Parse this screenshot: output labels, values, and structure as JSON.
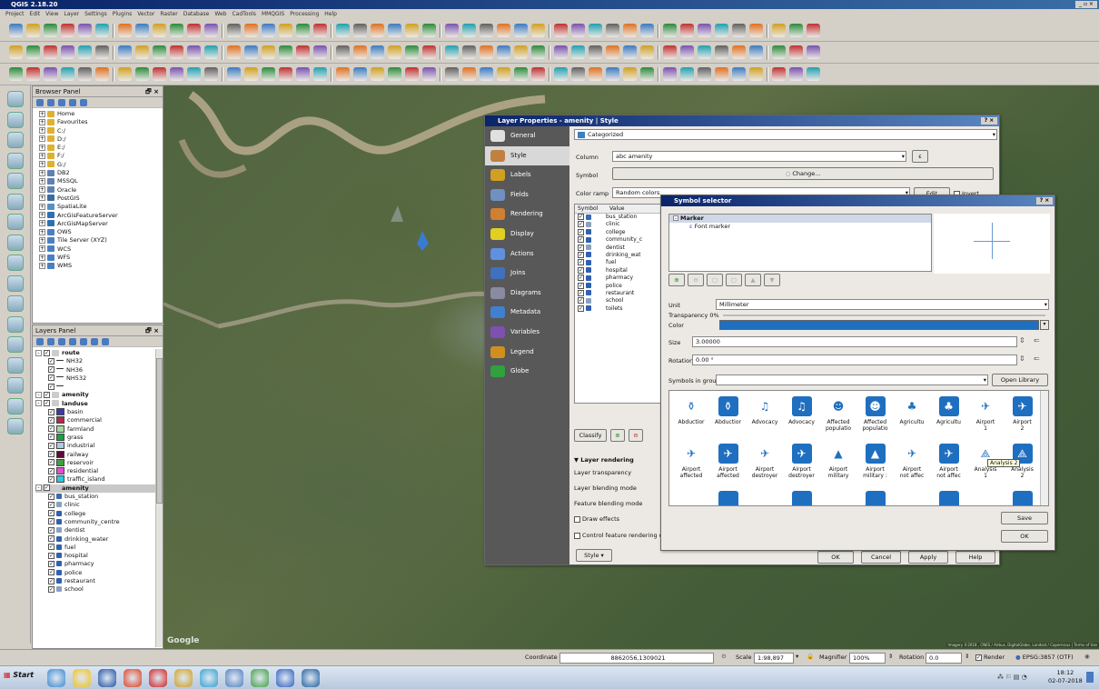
{
  "window": {
    "title": "QGIS 2.18.20",
    "controls": "_ ▫ ×"
  },
  "menu": [
    "Project",
    "Edit",
    "View",
    "Layer",
    "Settings",
    "Plugins",
    "Vector",
    "Raster",
    "Database",
    "Web",
    "CadTools",
    "MMQGIS",
    "Processing",
    "Help"
  ],
  "browser": {
    "title": "Browser Panel",
    "close": "🗗 ×",
    "items": [
      {
        "label": "Home",
        "indent": 1,
        "icon": "folder-icon",
        "color": "#e0b030"
      },
      {
        "label": "Favourites",
        "indent": 1,
        "icon": "star-icon",
        "color": "#e0b030"
      },
      {
        "label": "C:/",
        "indent": 1,
        "icon": "folder-icon",
        "color": "#e0b030"
      },
      {
        "label": "D:/",
        "indent": 1,
        "icon": "folder-icon",
        "color": "#e0b030"
      },
      {
        "label": "E:/",
        "indent": 1,
        "icon": "folder-icon",
        "color": "#e0b030"
      },
      {
        "label": "F:/",
        "indent": 1,
        "icon": "folder-icon",
        "color": "#e0b030"
      },
      {
        "label": "G:/",
        "indent": 1,
        "icon": "folder-icon",
        "color": "#e0b030"
      },
      {
        "label": "DB2",
        "indent": 1,
        "icon": "database-icon",
        "color": "#6080b0"
      },
      {
        "label": "MSSQL",
        "indent": 1,
        "icon": "database-icon",
        "color": "#6080b0"
      },
      {
        "label": "Oracle",
        "indent": 1,
        "icon": "database-icon",
        "color": "#6080b0"
      },
      {
        "label": "PostGIS",
        "indent": 1,
        "icon": "database-icon",
        "color": "#3a6aa0"
      },
      {
        "label": "SpatiaLite",
        "indent": 1,
        "icon": "database-icon",
        "color": "#5a90c0"
      },
      {
        "label": "ArcGisFeatureServer",
        "indent": 1,
        "icon": "globe-icon",
        "color": "#3070b0"
      },
      {
        "label": "ArcGisMapServer",
        "indent": 1,
        "icon": "globe-icon",
        "color": "#3070b0"
      },
      {
        "label": "OWS",
        "indent": 1,
        "icon": "globe-icon",
        "color": "#4a80c0"
      },
      {
        "label": "Tile Server (XYZ)",
        "indent": 1,
        "icon": "globe-icon",
        "color": "#4a80c0"
      },
      {
        "label": "WCS",
        "indent": 1,
        "icon": "globe-icon",
        "color": "#4a80c0"
      },
      {
        "label": "WFS",
        "indent": 1,
        "icon": "globe-icon",
        "color": "#4a80c0"
      },
      {
        "label": "WMS",
        "indent": 1,
        "icon": "globe-icon",
        "color": "#4a80c0"
      }
    ]
  },
  "layers": {
    "title": "Layers Panel",
    "close": "🗗 ×",
    "items": [
      {
        "label": "route",
        "bold": true,
        "indent": 0,
        "type": "group"
      },
      {
        "label": "NH32",
        "indent": 2,
        "type": "line"
      },
      {
        "label": "NH36",
        "indent": 2,
        "type": "line"
      },
      {
        "label": "NH532",
        "indent": 2,
        "type": "line"
      },
      {
        "label": "",
        "indent": 2,
        "type": "line"
      },
      {
        "label": "amenity",
        "bold": true,
        "indent": 0,
        "type": "group"
      },
      {
        "label": "landuse",
        "bold": true,
        "indent": 0,
        "type": "group"
      },
      {
        "label": "basin",
        "indent": 2,
        "type": "fill",
        "color": "#3a3aa8"
      },
      {
        "label": "commercial",
        "indent": 2,
        "type": "fill",
        "color": "#b02a4a"
      },
      {
        "label": "farmland",
        "indent": 2,
        "type": "fill",
        "color": "#a8d8a0"
      },
      {
        "label": "grass",
        "indent": 2,
        "type": "fill",
        "color": "#1aa040"
      },
      {
        "label": "industrial",
        "indent": 2,
        "type": "fill",
        "color": "#b0c8e0"
      },
      {
        "label": "railway",
        "indent": 2,
        "type": "fill",
        "color": "#5a0a3a"
      },
      {
        "label": "reservoir",
        "indent": 2,
        "type": "fill",
        "color": "#40a040"
      },
      {
        "label": "residential",
        "indent": 2,
        "type": "fill",
        "color": "#e050d0"
      },
      {
        "label": "traffic_island",
        "indent": 2,
        "type": "fill",
        "color": "#30c8e0"
      },
      {
        "label": "amenity",
        "bold": true,
        "indent": 0,
        "type": "group",
        "selected": true
      },
      {
        "label": "bus_station",
        "indent": 2,
        "type": "pt",
        "color": "#3a6ab0"
      },
      {
        "label": "clinic",
        "indent": 2,
        "type": "pt",
        "color": "#8aa0c0"
      },
      {
        "label": "college",
        "indent": 2,
        "type": "pt",
        "color": "#3060b0"
      },
      {
        "label": "community_centre",
        "indent": 2,
        "type": "pt",
        "color": "#3060b0"
      },
      {
        "label": "dentist",
        "indent": 2,
        "type": "pt",
        "color": "#8aa0c0"
      },
      {
        "label": "drinking_water",
        "indent": 2,
        "type": "pt",
        "color": "#3060b0"
      },
      {
        "label": "fuel",
        "indent": 2,
        "type": "pt",
        "color": "#3060b0"
      },
      {
        "label": "hospital",
        "indent": 2,
        "type": "pt",
        "color": "#3060b0"
      },
      {
        "label": "pharmacy",
        "indent": 2,
        "type": "pt",
        "color": "#3060b0"
      },
      {
        "label": "police",
        "indent": 2,
        "type": "pt",
        "color": "#3060b0"
      },
      {
        "label": "restaurant",
        "indent": 2,
        "type": "pt",
        "color": "#3060b0"
      },
      {
        "label": "school",
        "indent": 2,
        "type": "pt",
        "color": "#8aa0c0"
      }
    ]
  },
  "map": {
    "watermark": "Google",
    "attribution": "Imagery ©2018 , CNES / Airbus, DigitalGlobe, Landsat / Copernicus | Terms of Use"
  },
  "layer_properties": {
    "title": "Layer Properties - amenity | Style",
    "close": "? ×",
    "sidebar": [
      "General",
      "Style",
      "Labels",
      "Fields",
      "Rendering",
      "Display",
      "Actions",
      "Joins",
      "Diagrams",
      "Metadata",
      "Variables",
      "Legend",
      "Globe"
    ],
    "renderer": "Categorized",
    "column_label": "Column",
    "column_value": "abc amenity",
    "symbol_label": "Symbol",
    "change_button": "Change...",
    "color_ramp_label": "Color ramp",
    "color_ramp_value": "Random colors",
    "edit_button": "Edit",
    "invert_label": "Invert",
    "table_headers": [
      "Symbol",
      "Value"
    ],
    "categories": [
      "bus_station",
      "clinic",
      "college",
      "community_c",
      "dentist",
      "drinking_wat",
      "fuel",
      "hospital",
      "pharmacy",
      "police",
      "restaurant",
      "school",
      "toilets"
    ],
    "classify_button": "Classify",
    "layer_rendering_header": "▼ Layer rendering",
    "rendering_rows": [
      "Layer transparency",
      "Layer blending mode",
      "Feature blending mode"
    ],
    "draw_effects": "Draw effects",
    "control_order": "Control feature rendering o",
    "style_button": "Style",
    "ok": "OK",
    "cancel": "Cancel",
    "apply": "Apply",
    "help": "Help"
  },
  "symbol_selector": {
    "title": "Symbol selector",
    "close": "? ×",
    "tree_root": "Marker",
    "tree_child": "Font marker",
    "unit_label": "Unit",
    "unit_value": "Millimeter",
    "transparency_label": "Transparency 0%",
    "color_label": "Color",
    "color_value": "#1f6fc0",
    "size_label": "Size",
    "size_value": "3.00000",
    "rotation_label": "Rotation",
    "rotation_value": "0.00 °",
    "symbols_group_label": "Symbols in group",
    "open_library": "Open Library",
    "row1": [
      [
        "Abductior",
        "",
        "#1f6fc0",
        "⚱",
        false
      ],
      [
        "Abductior",
        "",
        "#1f6fc0",
        "⚱",
        true
      ],
      [
        "Advocacy",
        "",
        "#1f6fc0",
        "♫",
        false
      ],
      [
        "Advocacy",
        "",
        "#1f6fc0",
        "♫",
        true
      ],
      [
        "Affected",
        "populatio",
        "#1f6fc0",
        "☻",
        false
      ],
      [
        "Affected",
        "populatio",
        "#1f6fc0",
        "☻",
        true
      ],
      [
        "Agricultu",
        "",
        "#1f6fc0",
        "♣",
        false
      ],
      [
        "Agricultu",
        "",
        "#1f6fc0",
        "♣",
        true
      ],
      [
        "Airport",
        "1",
        "#1f6fc0",
        "✈",
        false
      ],
      [
        "Airport",
        "2",
        "#1f6fc0",
        "✈",
        true
      ]
    ],
    "row2": [
      [
        "Airport",
        "affected",
        "#1f6fc0",
        "✈",
        false
      ],
      [
        "Airport",
        "affected",
        "#1f6fc0",
        "✈",
        true
      ],
      [
        "Airport",
        "destroyer",
        "#1f6fc0",
        "✈",
        false
      ],
      [
        "Airport",
        "destroyer",
        "#1f6fc0",
        "✈",
        true
      ],
      [
        "Airport",
        "military",
        "#1f6fc0",
        "▲",
        false
      ],
      [
        "Airport",
        "military :",
        "#1f6fc0",
        "▲",
        true
      ],
      [
        "Airport",
        "not affec",
        "#1f6fc0",
        "✈",
        false
      ],
      [
        "Airport",
        "not affec",
        "#1f6fc0",
        "✈",
        true
      ],
      [
        "Analysis",
        "1",
        "#1f6fc0",
        "⟁",
        false
      ],
      [
        "Analysis",
        "2",
        "#1f6fc0",
        "⟁",
        true
      ]
    ],
    "tooltip": "Analysis 2",
    "save": "Save",
    "ok": "OK"
  },
  "statusbar": {
    "coordinate_label": "Coordinate",
    "coordinate_value": "8862056,1309021",
    "scale_label": "Scale",
    "scale_value": "1:98,897",
    "magnifier_label": "Magnifier",
    "magnifier_value": "100%",
    "rotation_label": "Rotation",
    "rotation_value": "0.0",
    "render_label": "Render",
    "crs": "EPSG:3857 (OTF)"
  },
  "taskbar": {
    "start": "Start",
    "time": "18:12",
    "date": "02-07-2018"
  }
}
